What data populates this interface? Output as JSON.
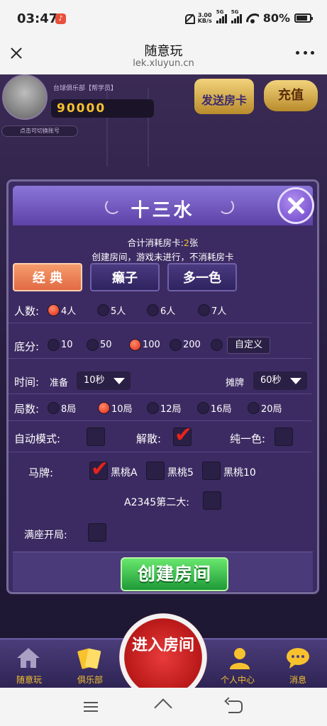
{
  "status_bar": {
    "time": "03:47",
    "speed_value": "3.00",
    "speed_unit": "KB/s",
    "sig1": "5G",
    "sig2": "5G",
    "battery": "80%"
  },
  "browser": {
    "title": "随意玩",
    "url": "lek.xluyun.cn"
  },
  "profile": {
    "club": "台球俱乐部【帮学员】",
    "coins": "90000",
    "switch_account": "点击可切换账号"
  },
  "top_buttons": {
    "send_card": "发送房卡",
    "recharge": "充值"
  },
  "modal": {
    "title": "十三水",
    "cost_prefix": "合计消耗房卡:",
    "cost_value": "2",
    "cost_suffix": "张",
    "notice": "创建房间，游戏未进行，不消耗房卡",
    "modes": [
      "经 典",
      "癞子",
      "多一色"
    ],
    "players": {
      "label": "人数:",
      "options": [
        "4人",
        "5人",
        "6人",
        "7人"
      ],
      "selected": 0
    },
    "base": {
      "label": "底分:",
      "options": [
        "10",
        "50",
        "100",
        "200"
      ],
      "selected": 2,
      "custom": "自定义"
    },
    "time": {
      "label": "时间:",
      "ready_label": "准备",
      "ready_value": "10秒",
      "deal_label": "摊牌",
      "deal_value": "60秒"
    },
    "rounds": {
      "label": "局数:",
      "options": [
        "8局",
        "10局",
        "12局",
        "16局",
        "20局"
      ],
      "selected": 1
    },
    "toggles": {
      "auto": "自动模式:",
      "dissolve": "解散:",
      "pure": "纯一色:"
    },
    "horse": {
      "label": "马牌:",
      "options": [
        "黑桃A",
        "黑桃5",
        "黑桃10"
      ]
    },
    "a2345": "A2345第二大:",
    "full_start": "满座开局:",
    "create_button": "创建房间"
  },
  "game_nav": {
    "home": "随意玩",
    "club": "俱乐部",
    "enter_room": "进入房间",
    "profile": "个人中心",
    "messages": "消息"
  },
  "colors": {
    "accent_gold": "#f7c22e",
    "modal_bg": "#3c2b62",
    "create_green": "#1f9a37",
    "active_tab": "#e26a44"
  }
}
